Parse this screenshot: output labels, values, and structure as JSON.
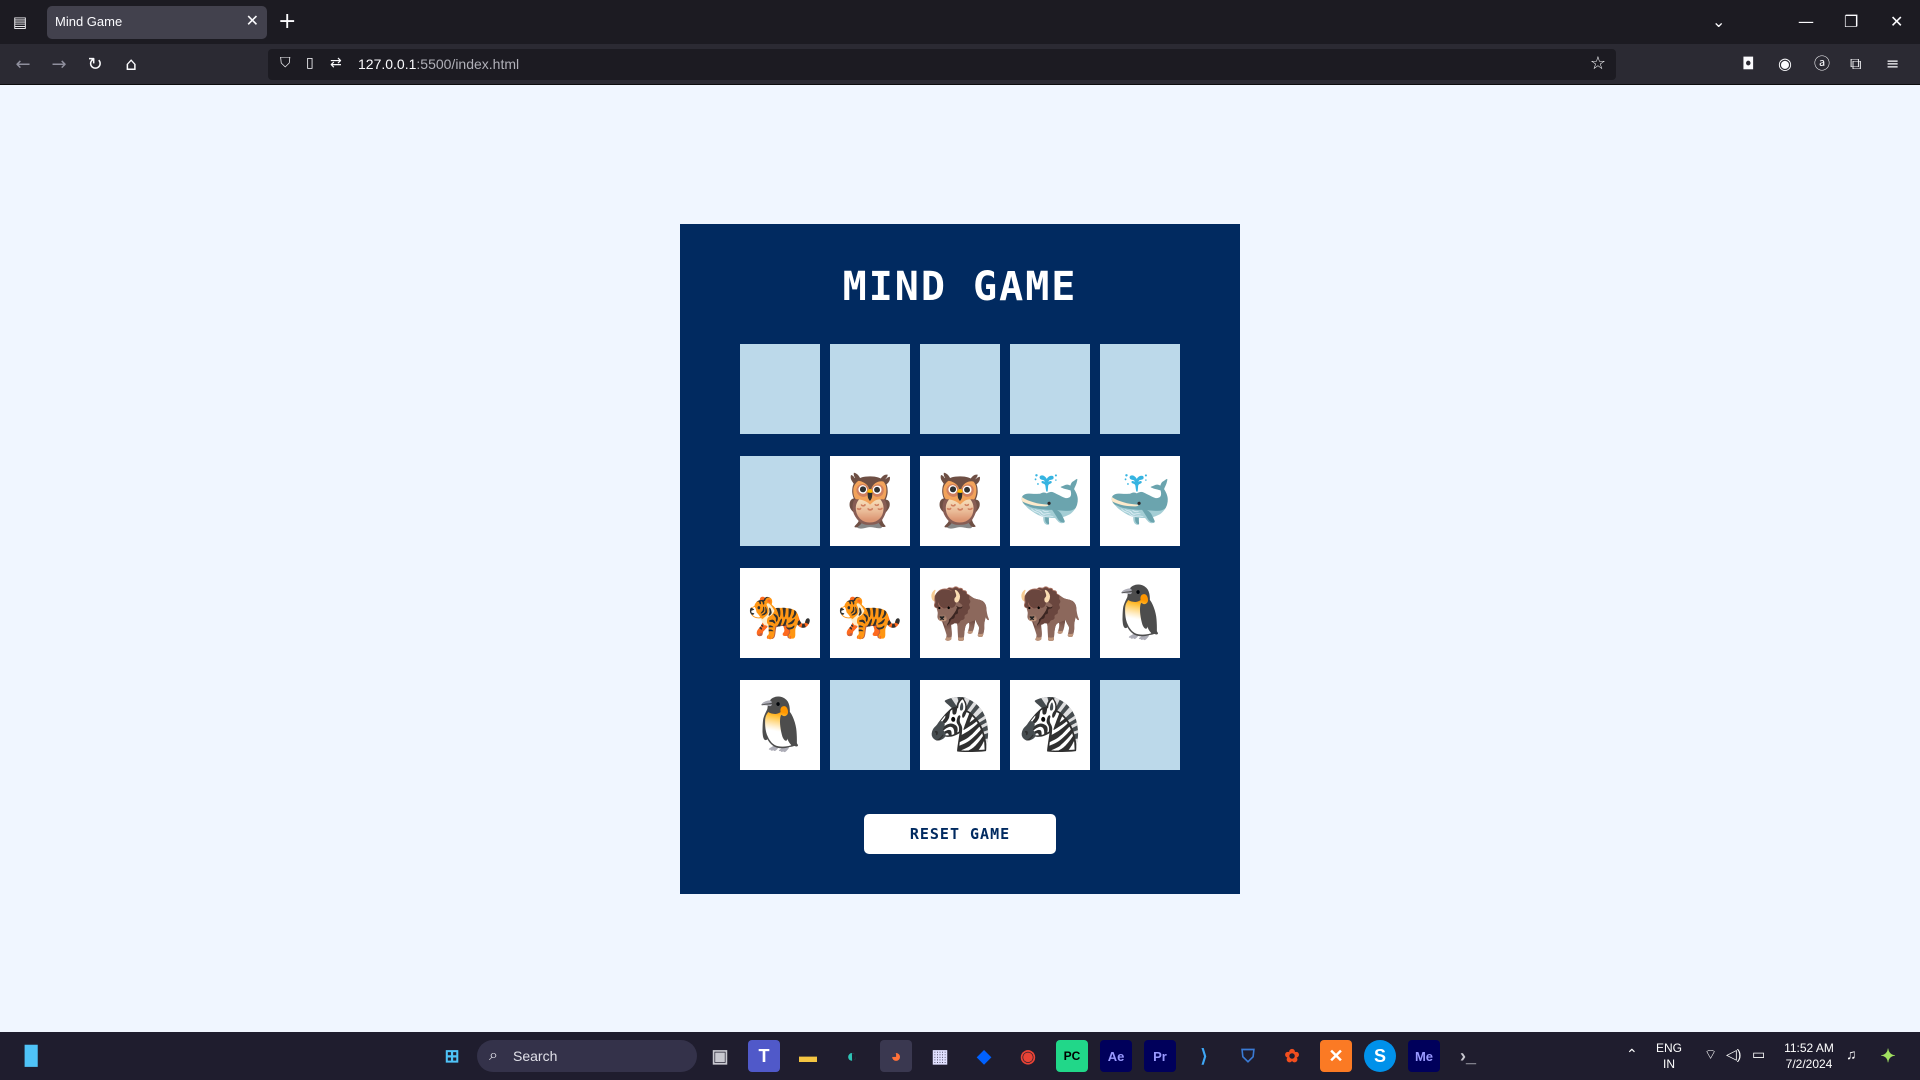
{
  "browser": {
    "tab_title": "Mind Game",
    "tab_close": "✕",
    "new_tab": "+",
    "url_host": "127.0.0.1",
    "url_rest": ":5500/index.html"
  },
  "game": {
    "title": "MIND GAME",
    "reset_label": "RESET GAME",
    "cards": [
      {
        "flipped": false,
        "face": "",
        "name": "hidden"
      },
      {
        "flipped": false,
        "face": "",
        "name": "hidden"
      },
      {
        "flipped": false,
        "face": "",
        "name": "hidden"
      },
      {
        "flipped": false,
        "face": "",
        "name": "hidden"
      },
      {
        "flipped": false,
        "face": "",
        "name": "hidden"
      },
      {
        "flipped": false,
        "face": "",
        "name": "hidden"
      },
      {
        "flipped": true,
        "face": "🦉",
        "name": "owl"
      },
      {
        "flipped": true,
        "face": "🦉",
        "name": "owl"
      },
      {
        "flipped": true,
        "face": "🐳",
        "name": "whale"
      },
      {
        "flipped": true,
        "face": "🐳",
        "name": "whale"
      },
      {
        "flipped": true,
        "face": "🐅",
        "name": "tiger"
      },
      {
        "flipped": true,
        "face": "🐅",
        "name": "tiger"
      },
      {
        "flipped": true,
        "face": "🦬",
        "name": "bison"
      },
      {
        "flipped": true,
        "face": "🦬",
        "name": "bison"
      },
      {
        "flipped": true,
        "face": "🐧",
        "name": "penguin"
      },
      {
        "flipped": true,
        "face": "🐧",
        "name": "penguin"
      },
      {
        "flipped": false,
        "face": "",
        "name": "hidden"
      },
      {
        "flipped": true,
        "face": "🦓",
        "name": "zebra"
      },
      {
        "flipped": true,
        "face": "🦓",
        "name": "zebra"
      },
      {
        "flipped": false,
        "face": "",
        "name": "hidden"
      }
    ]
  },
  "taskbar": {
    "search_label": "Search",
    "lang_top": "ENG",
    "lang_bottom": "IN",
    "time": "11:52 AM",
    "date": "7/2/2024"
  },
  "colors": {
    "page_bg": "#f0f6ff",
    "panel_bg": "#012a60",
    "hidden_card": "#bcd9ea",
    "shown_card": "#ffffff"
  }
}
